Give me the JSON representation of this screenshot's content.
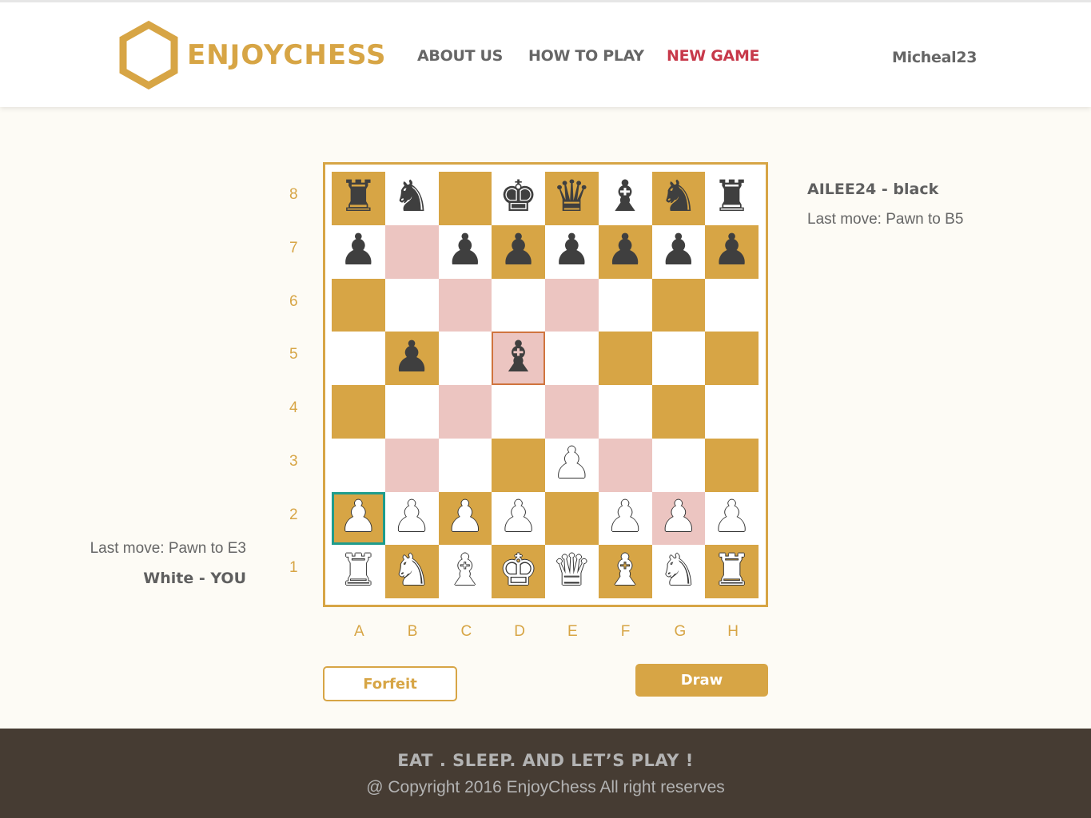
{
  "header": {
    "logo_text": "ENJOYCHESS",
    "nav": [
      {
        "label": "ABOUT US"
      },
      {
        "label": "HOW TO PLAY"
      },
      {
        "label": "NEW GAME",
        "active": true
      }
    ],
    "username": "Micheal23"
  },
  "colors": {
    "accent": "#d7a545",
    "active_nav": "#c7394a",
    "highlight": "#ecc5c1",
    "selected_border": "#d0743e",
    "focus_border": "#1f9c8c",
    "footer_bg": "#463c33"
  },
  "board": {
    "ranks": [
      "8",
      "7",
      "6",
      "5",
      "4",
      "3",
      "2",
      "1"
    ],
    "files": [
      "A",
      "B",
      "C",
      "D",
      "E",
      "F",
      "G",
      "H"
    ],
    "rows": [
      [
        "br",
        "bn",
        "",
        "bk",
        "bq",
        "bb",
        "bn",
        "br"
      ],
      [
        "bp",
        "",
        "bp",
        "bp",
        "bp",
        "bp",
        "bp",
        "bp"
      ],
      [
        "",
        "",
        "",
        "",
        "",
        "",
        "",
        ""
      ],
      [
        "",
        "bp",
        "",
        "bb",
        "",
        "",
        "",
        ""
      ],
      [
        "",
        "",
        "",
        "",
        "",
        "",
        "",
        ""
      ],
      [
        "",
        "",
        "",
        "",
        "wp",
        "",
        "",
        ""
      ],
      [
        "wp",
        "wp",
        "wp",
        "wp",
        "",
        "wp",
        "wp",
        "wp"
      ],
      [
        "wr",
        "wn",
        "wb",
        "wk",
        "wq",
        "wb",
        "wn",
        "wr"
      ]
    ],
    "highlighted_squares": [
      "B7",
      "C6",
      "E6",
      "C4",
      "E4",
      "B3",
      "F3",
      "G2"
    ],
    "selected_square": "D5",
    "focused_square": "A2"
  },
  "opponent": {
    "name_label": "AILEE24 - black",
    "last_move": "Last move: Pawn to B5"
  },
  "player": {
    "last_move": "Last move: Pawn to E3",
    "name_label": "White - YOU"
  },
  "actions": {
    "forfeit_label": "Forfeit",
    "draw_label": "Draw"
  },
  "footer": {
    "slogan": "EAT . SLEEP. AND LET’S PLAY !",
    "copyright": "@ Copyright 2016 EnjoyChess All right reserves"
  }
}
